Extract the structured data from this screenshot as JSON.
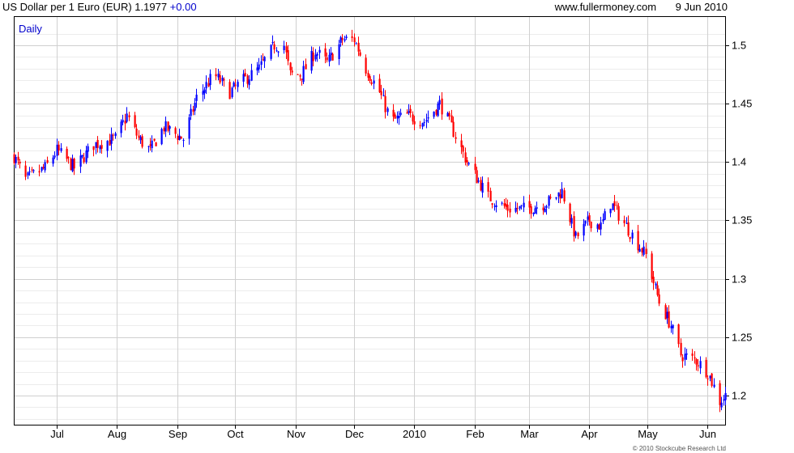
{
  "header": {
    "title": "US Dollar per 1 Euro (EUR)",
    "last": "1.1977",
    "change": "+0.00",
    "site": "www.fullermoney.com",
    "date": "9 Jun 2010"
  },
  "footer": {
    "copyright": "© 2010 Stockcube Research Ltd"
  },
  "chart_data": {
    "type": "candlestick",
    "interval": "Daily",
    "colors": {
      "up": "#0000ff",
      "down": "#ff0000",
      "grid": "#d0d0d0",
      "text_blue": "#0000cc"
    },
    "grid": true,
    "ylim": [
      1.175,
      1.525
    ],
    "y_ticks": [
      1.2,
      1.25,
      1.3,
      1.35,
      1.4,
      1.45,
      1.5
    ],
    "y_tick_labels": [
      "1.2",
      "1.25",
      "1.3",
      "1.35",
      "1.4",
      "1.45",
      "1.5"
    ],
    "x_range": [
      "2009-06-09",
      "2010-06-10"
    ],
    "x_ticks": [
      {
        "date": "2009-07-01",
        "label": "Jul"
      },
      {
        "date": "2009-08-01",
        "label": "Aug"
      },
      {
        "date": "2009-09-01",
        "label": "Sep"
      },
      {
        "date": "2009-10-01",
        "label": "Oct"
      },
      {
        "date": "2009-11-01",
        "label": "Nov"
      },
      {
        "date": "2009-12-01",
        "label": "Dec"
      },
      {
        "date": "2010-01-01",
        "label": "2010"
      },
      {
        "date": "2010-02-01",
        "label": "Feb"
      },
      {
        "date": "2010-03-01",
        "label": "Mar"
      },
      {
        "date": "2010-04-01",
        "label": "Apr"
      },
      {
        "date": "2010-05-01",
        "label": "May"
      },
      {
        "date": "2010-06-01",
        "label": "Jun"
      }
    ],
    "close_trajectory": [
      [
        "2009-06-09",
        1.405
      ],
      [
        "2009-06-15",
        1.385
      ],
      [
        "2009-06-25",
        1.395
      ],
      [
        "2009-07-01",
        1.41
      ],
      [
        "2009-07-10",
        1.395
      ],
      [
        "2009-07-20",
        1.415
      ],
      [
        "2009-07-31",
        1.42
      ],
      [
        "2009-08-06",
        1.44
      ],
      [
        "2009-08-12",
        1.42
      ],
      [
        "2009-08-18",
        1.41
      ],
      [
        "2009-08-25",
        1.43
      ],
      [
        "2009-09-04",
        1.42
      ],
      [
        "2009-09-11",
        1.455
      ],
      [
        "2009-09-20",
        1.475
      ],
      [
        "2009-09-28",
        1.46
      ],
      [
        "2009-10-05",
        1.47
      ],
      [
        "2009-10-13",
        1.48
      ],
      [
        "2009-10-21",
        1.5
      ],
      [
        "2009-10-26",
        1.5
      ],
      [
        "2009-10-29",
        1.475
      ],
      [
        "2009-11-04",
        1.475
      ],
      [
        "2009-11-11",
        1.495
      ],
      [
        "2009-11-17",
        1.485
      ],
      [
        "2009-11-25",
        1.505
      ],
      [
        "2009-12-01",
        1.505
      ],
      [
        "2009-12-07",
        1.48
      ],
      [
        "2009-12-14",
        1.46
      ],
      [
        "2009-12-20",
        1.435
      ],
      [
        "2009-12-28",
        1.44
      ],
      [
        "2010-01-06",
        1.435
      ],
      [
        "2010-01-14",
        1.45
      ],
      [
        "2010-01-20",
        1.43
      ],
      [
        "2010-01-28",
        1.4
      ],
      [
        "2010-02-08",
        1.37
      ],
      [
        "2010-02-18",
        1.36
      ],
      [
        "2010-02-28",
        1.36
      ],
      [
        "2010-03-10",
        1.365
      ],
      [
        "2010-03-18",
        1.375
      ],
      [
        "2010-03-25",
        1.335
      ],
      [
        "2010-04-01",
        1.35
      ],
      [
        "2010-04-07",
        1.345
      ],
      [
        "2010-04-12",
        1.365
      ],
      [
        "2010-04-20",
        1.345
      ],
      [
        "2010-04-30",
        1.32
      ],
      [
        "2010-05-07",
        1.28
      ],
      [
        "2010-05-13",
        1.26
      ],
      [
        "2010-05-18",
        1.235
      ],
      [
        "2010-05-26",
        1.23
      ],
      [
        "2010-06-01",
        1.22
      ],
      [
        "2010-06-07",
        1.195
      ],
      [
        "2010-06-10",
        1.2
      ]
    ]
  }
}
